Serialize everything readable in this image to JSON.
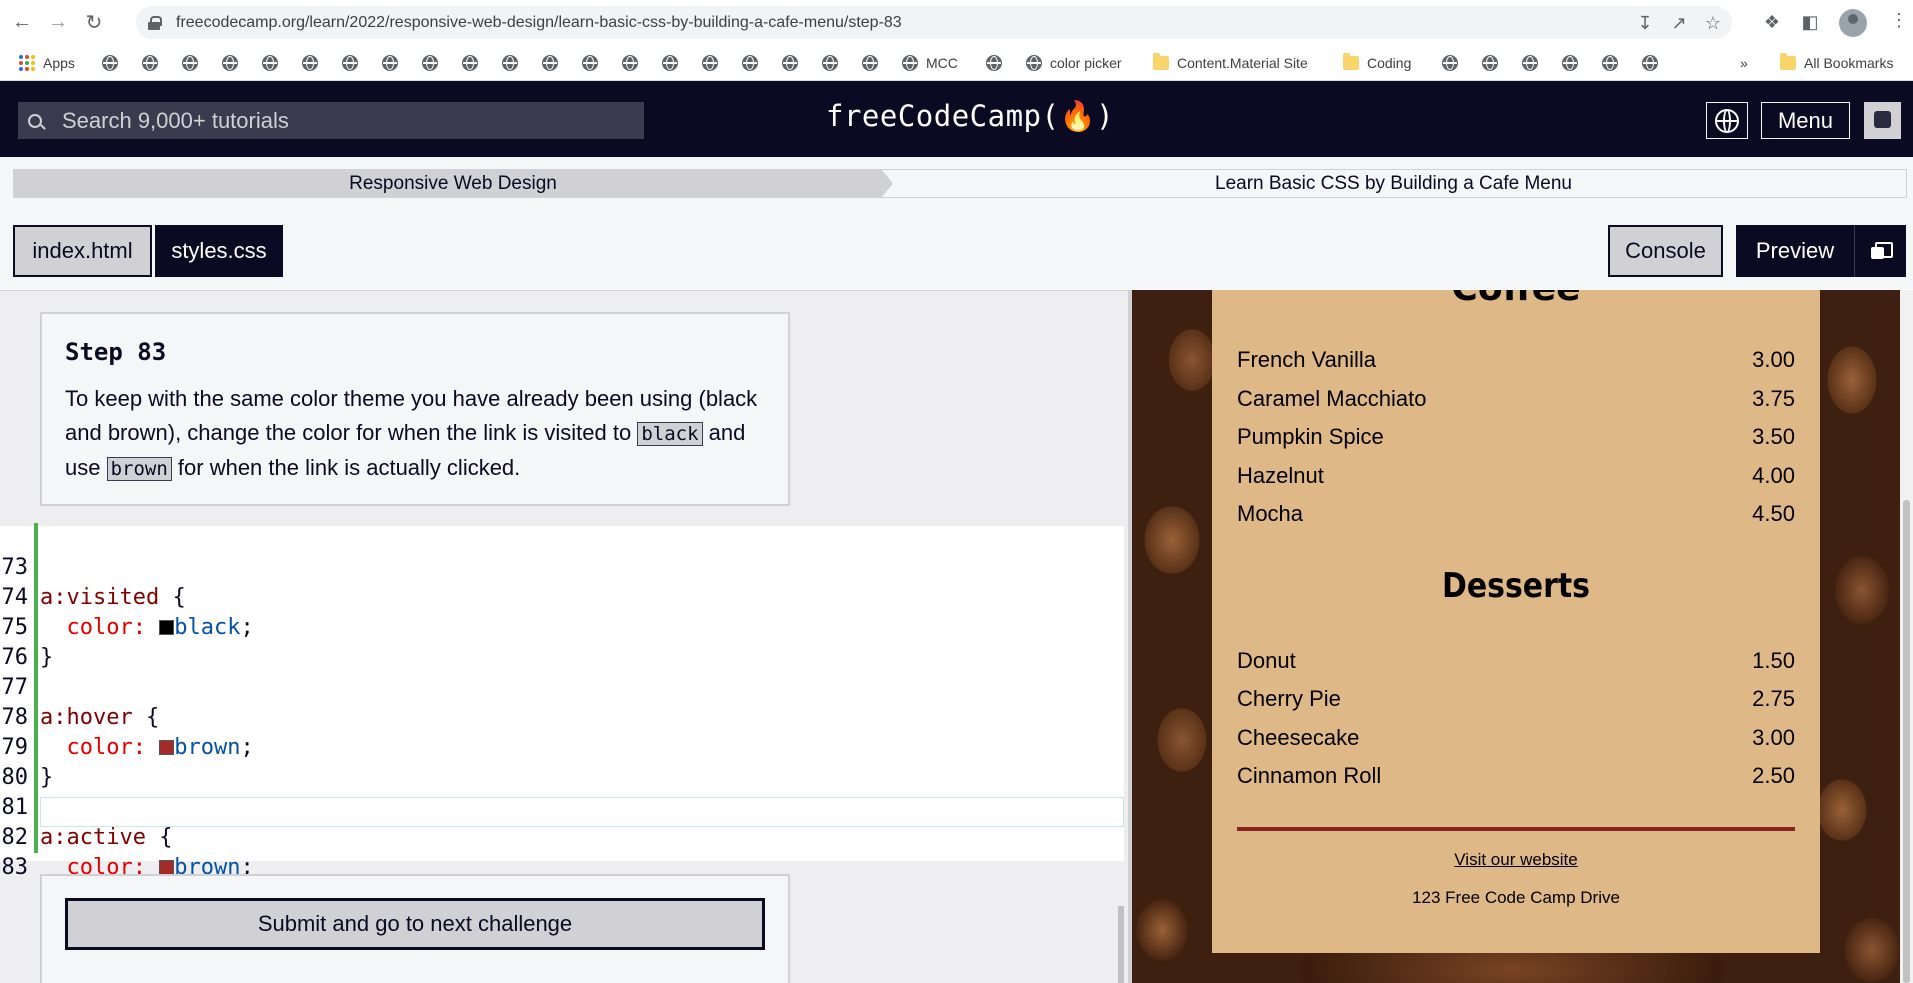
{
  "browser": {
    "url": "freecodecamp.org/learn/2022/responsive-web-design/learn-basic-css-by-building-a-cafe-menu/step-83",
    "bookmarks": {
      "apps": "Apps",
      "mcc": "MCC",
      "color_picker": "color picker",
      "content_material": "Content.Material Site",
      "coding": "Coding",
      "all_bookmarks": "All Bookmarks",
      "overflow": "»"
    }
  },
  "navbar": {
    "search_placeholder": "Search 9,000+ tutorials",
    "logo": "freeCodeCamp(🔥)",
    "menu_label": "Menu"
  },
  "breadcrumb": {
    "superblock": "Responsive Web Design",
    "block": "Learn Basic CSS by Building a Cafe Menu"
  },
  "editor_tabs": {
    "index": "index.html",
    "styles": "styles.css",
    "console": "Console",
    "preview": "Preview"
  },
  "step": {
    "title": "Step 83",
    "text_1": "To keep with the same color theme you have already been using (black and brown), change the color for when the link is visited to ",
    "code_1": "black",
    "text_2": " and use ",
    "code_2": "brown",
    "text_3": " for when the link is actually clicked."
  },
  "code": {
    "lines": [
      {
        "num": "73",
        "selector": "a:visited",
        "brace": " {"
      },
      {
        "num": "74",
        "prop": "color:",
        "swatch": "#000000",
        "value": "black",
        "semi": ";"
      },
      {
        "num": "75",
        "text": "}"
      },
      {
        "num": "76",
        "text": ""
      },
      {
        "num": "77",
        "selector": "a:hover",
        "brace": " {"
      },
      {
        "num": "78",
        "prop": "color:",
        "swatch": "#a52a2a",
        "value": "brown",
        "semi": ";"
      },
      {
        "num": "79",
        "text": "}"
      },
      {
        "num": "80",
        "text": ""
      },
      {
        "num": "81",
        "selector": "a:active",
        "brace": " {"
      },
      {
        "num": "82",
        "prop": "color:",
        "swatch": "#a52a2a",
        "value": "brown",
        "semi": ";"
      },
      {
        "num": "83",
        "text": "}"
      }
    ]
  },
  "submit": {
    "label": "Submit and go to next challenge"
  },
  "preview": {
    "coffee_heading": "Coffee",
    "coffee_items": [
      {
        "flavor": "French Vanilla",
        "price": "3.00"
      },
      {
        "flavor": "Caramel Macchiato",
        "price": "3.75"
      },
      {
        "flavor": "Pumpkin Spice",
        "price": "3.50"
      },
      {
        "flavor": "Hazelnut",
        "price": "4.00"
      },
      {
        "flavor": "Mocha",
        "price": "4.50"
      }
    ],
    "desserts_heading": "Desserts",
    "dessert_items": [
      {
        "flavor": "Donut",
        "price": "1.50"
      },
      {
        "flavor": "Cherry Pie",
        "price": "2.75"
      },
      {
        "flavor": "Cheesecake",
        "price": "3.00"
      },
      {
        "flavor": "Cinnamon Roll",
        "price": "2.50"
      }
    ],
    "visit_link": "Visit our website",
    "address": "123 Free Code Camp Drive"
  },
  "colors": {
    "nav_bg": "#0a0a23",
    "menu_bg": "#deb887",
    "brown": "#a52a2a"
  }
}
